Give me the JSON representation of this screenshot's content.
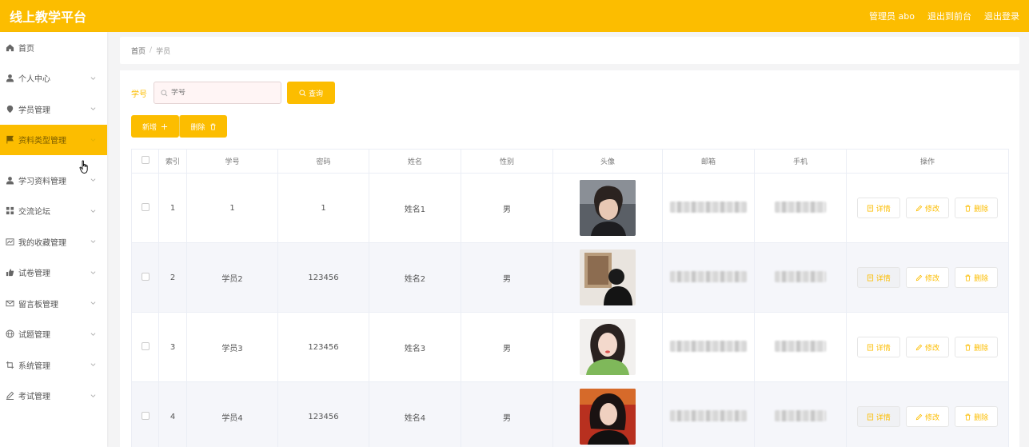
{
  "header": {
    "brand": "线上教学平台",
    "user": "管理员 abo",
    "front_link": "退出到前台",
    "logout": "退出登录"
  },
  "sidebar": {
    "items": [
      {
        "label": "首页",
        "icon": "home-icon"
      },
      {
        "label": "个人中心",
        "icon": "user-icon"
      },
      {
        "label": "学员管理",
        "icon": "location-icon"
      },
      {
        "label": "资料类型管理",
        "icon": "flag-icon",
        "active": true
      },
      {
        "label": "学习资料管理",
        "icon": "user-icon"
      },
      {
        "label": "交流论坛",
        "icon": "grid-icon"
      },
      {
        "label": "我的收藏管理",
        "icon": "chart-icon"
      },
      {
        "label": "试卷管理",
        "icon": "thumb-icon"
      },
      {
        "label": "留言板管理",
        "icon": "mail-icon"
      },
      {
        "label": "试题管理",
        "icon": "globe-icon"
      },
      {
        "label": "系统管理",
        "icon": "crop-icon"
      },
      {
        "label": "考试管理",
        "icon": "pen-icon"
      }
    ]
  },
  "breadcrumb": {
    "home": "首页",
    "sep": "/",
    "current": "学员"
  },
  "search": {
    "label": "学号",
    "placeholder": "学号",
    "button": "查询"
  },
  "actions": {
    "add": "新增",
    "delete": "删除"
  },
  "table": {
    "headers": [
      "索引",
      "学号",
      "密码",
      "姓名",
      "性别",
      "头像",
      "邮箱",
      "手机",
      "操作"
    ],
    "rows": [
      {
        "index": "1",
        "id": "1",
        "password": "1",
        "name": "姓名1",
        "gender": "男"
      },
      {
        "index": "2",
        "id": "学员2",
        "password": "123456",
        "name": "姓名2",
        "gender": "男"
      },
      {
        "index": "3",
        "id": "学员3",
        "password": "123456",
        "name": "姓名3",
        "gender": "男"
      },
      {
        "index": "4",
        "id": "学员4",
        "password": "123456",
        "name": "姓名4",
        "gender": "男"
      }
    ],
    "ops": {
      "detail": "详情",
      "edit": "修改",
      "remove": "删除"
    }
  },
  "colors": {
    "accent": "#fcbd00"
  }
}
